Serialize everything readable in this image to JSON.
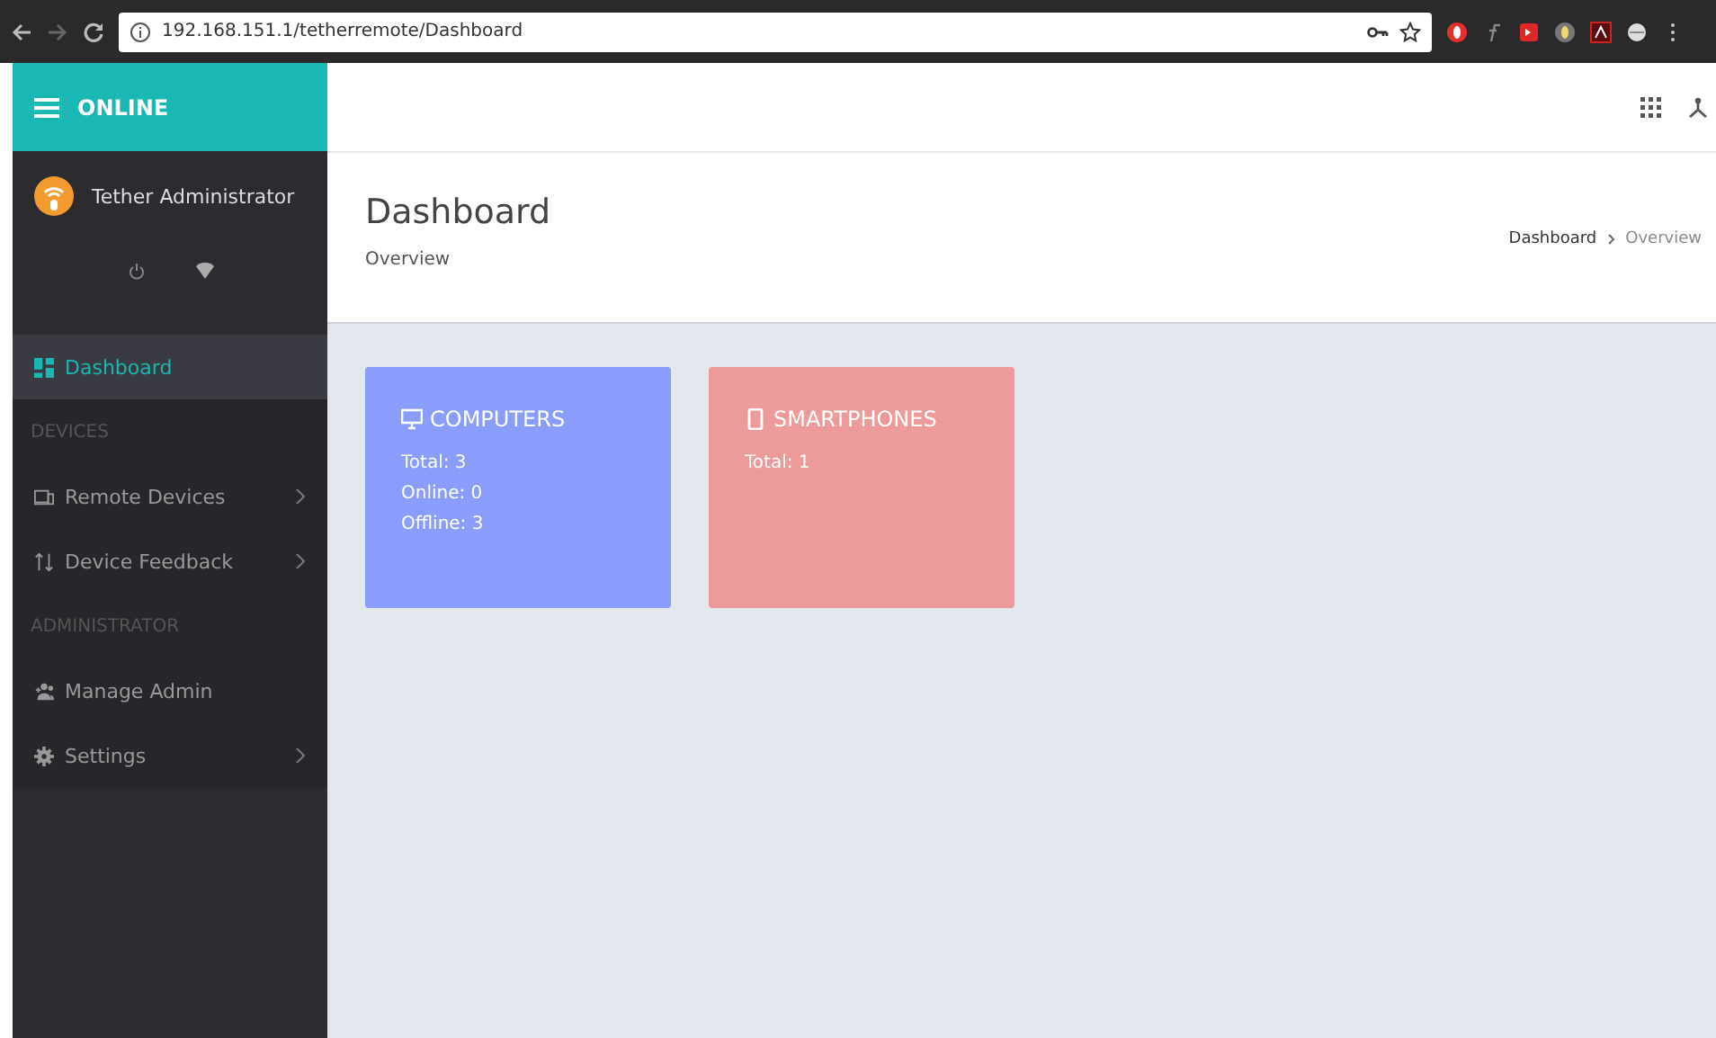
{
  "browser": {
    "url": "192.168.151.1/tetherremote/Dashboard"
  },
  "topbar": {
    "status": "ONLINE"
  },
  "user": {
    "name": "Tether Administrator"
  },
  "sidebar": {
    "items": [
      {
        "kind": "item",
        "label": "Dashboard",
        "selected": true,
        "expandable": false
      },
      {
        "kind": "section",
        "label": "DEVICES"
      },
      {
        "kind": "item",
        "label": "Remote Devices",
        "selected": false,
        "expandable": true
      },
      {
        "kind": "item",
        "label": "Device Feedback",
        "selected": false,
        "expandable": true
      },
      {
        "kind": "section",
        "label": "ADMINISTRATOR"
      },
      {
        "kind": "item",
        "label": "Manage Admin",
        "selected": false,
        "expandable": false
      },
      {
        "kind": "item",
        "label": "Settings",
        "selected": false,
        "expandable": true
      }
    ]
  },
  "page_header": {
    "title": "Dashboard",
    "subtitle": "Overview",
    "breadcrumb": [
      "Dashboard",
      "Overview"
    ]
  },
  "cards": [
    {
      "title": "COMPUTERS",
      "color": "#8b9dfc",
      "lines": [
        "Total: 3",
        "Online: 0",
        "Offline: 3"
      ]
    },
    {
      "title": "SMARTPHONES",
      "color": "#ec9a9a",
      "lines": [
        "Total: 1"
      ]
    }
  ]
}
